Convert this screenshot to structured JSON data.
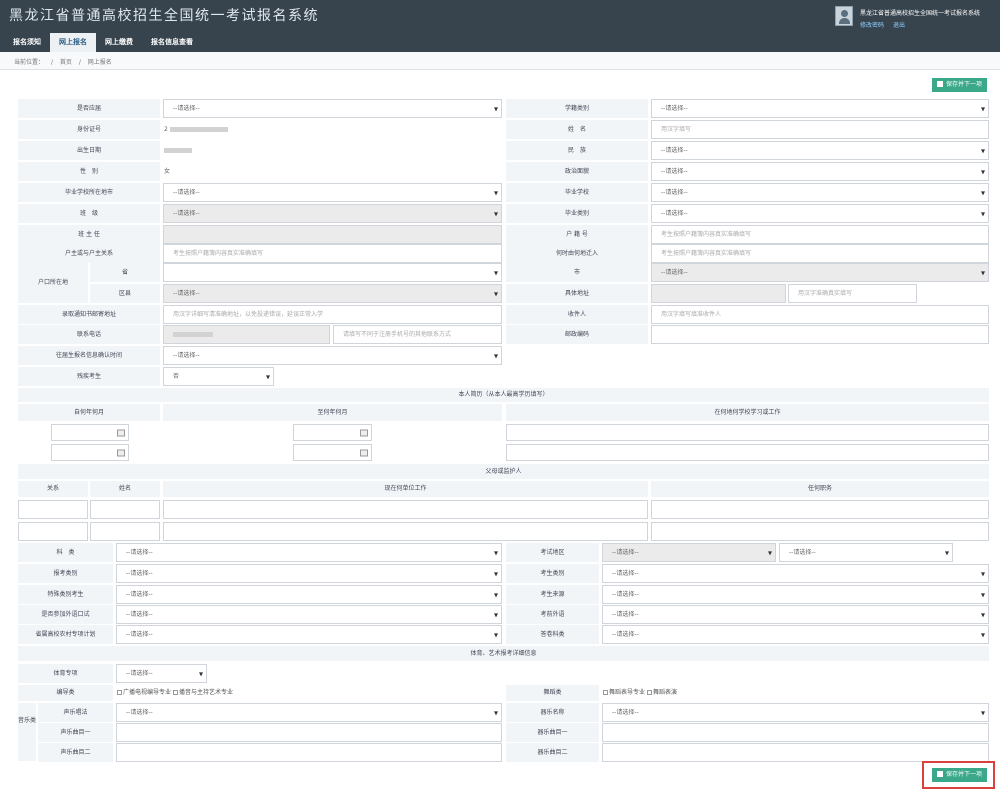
{
  "app_title": "黑龙江省普通高校招生全国统一考试报名系统",
  "nav": {
    "tabs": [
      "报名须知",
      "网上报名",
      "网上缴费",
      "报名信息查看"
    ]
  },
  "user": {
    "name": "黑龙江省普通高校招生全国统一考试报名系统",
    "change_password": "修改密码",
    "logout": "退出"
  },
  "breadcrumb": {
    "label": "当前位置：",
    "sep": "/",
    "home": "首页",
    "current": "网上报名"
  },
  "buttons": {
    "save_next": "保存并下一项"
  },
  "defaults": {
    "select": "--请选择--",
    "no": "否",
    "gender": "女",
    "id_prefix": "2"
  },
  "labels": {
    "r1a": "是否应届",
    "r1b": "学籍类别",
    "r2a": "身份证号",
    "r2b": "姓　名",
    "r3a": "出生日期",
    "r3b": "民　族",
    "r4a": "性　别",
    "r4b": "政治面貌",
    "r5a": "毕业学校所在地市",
    "r5b": "毕业学校",
    "r6a": "班　级",
    "r6b": "毕业类别",
    "r7a": "班 主 任",
    "r7b": "户 籍 号",
    "r8a": "户主或与户主关系",
    "r8b": "何时由何地迁入",
    "hukou": "户口所在地",
    "prov": "省",
    "city": "市",
    "district": "区县",
    "addr": "具体地址",
    "r11a": "录取通知书邮寄地址",
    "r11b": "收件人",
    "r12a": "联系电话",
    "r12b": "邮政编码",
    "r13": "往届生报名信息确认时间",
    "r14": "残疾考生",
    "resume_section": "本人简历（从本人最高学历填写）",
    "from": "自何年何月",
    "to": "至何年何月",
    "where": "在何地何学校学习或工作",
    "family_section": "父母或监护人",
    "relation": "关系",
    "fname": "姓名",
    "workplace": "现在何单位工作",
    "position": "任何职务",
    "subject": "科　类",
    "exam_area": "考试地区",
    "reg_type": "报考类别",
    "cand_type": "考生类别",
    "special": "特殊类别考生",
    "source": "考生来源",
    "foreign_oral": "是否参加外语口试",
    "foreign": "考前外语",
    "rural": "省属高校农村专项计划",
    "exam_lang": "答卷科类",
    "art_section": "体育、艺术报考详细信息",
    "sports": "体育专项",
    "director": "编导类",
    "dance": "舞蹈类",
    "music_vert": "音乐类",
    "vocal": "声乐唱法",
    "instrument": "器乐名称",
    "vocal1": "声乐曲目一",
    "inst1": "器乐曲目一",
    "vocal2": "声乐曲目二",
    "inst2": "器乐曲目二"
  },
  "placeholders": {
    "name": "用汉字填写",
    "hukou_no": "考生按照户籍簿内容真实准确填写",
    "householder": "考生按照户籍簿内容真实准确填写",
    "moved": "考生按照户籍簿内容真实准确填写",
    "addr": "用汉字准确真实填写",
    "mail_addr": "用汉字详细写清准确地址，以免投递错误，延误正常入学",
    "recipient": "用汉字填写填准收件人",
    "phone2": "请填写不同于注册手机号的其他联系方式"
  },
  "options": {
    "director": [
      "广播电视编导专业",
      "播音与主持艺术专业"
    ],
    "dance": [
      "舞蹈表导专业",
      "舞蹈表演"
    ]
  }
}
